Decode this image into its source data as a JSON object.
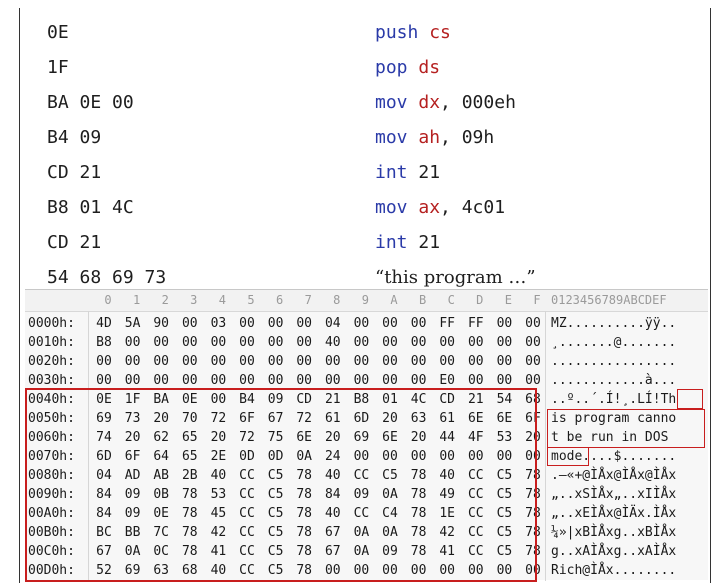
{
  "assembly_lines": [
    {
      "hex": "0E",
      "parts": [
        [
          "mn",
          "push"
        ],
        [
          "op",
          " "
        ],
        [
          "rg",
          "cs"
        ]
      ]
    },
    {
      "hex": "1F",
      "parts": [
        [
          "mn",
          "pop"
        ],
        [
          "op",
          " "
        ],
        [
          "rg",
          "ds"
        ]
      ]
    },
    {
      "hex": "BA 0E 00",
      "parts": [
        [
          "mn",
          "mov"
        ],
        [
          "op",
          " "
        ],
        [
          "rg",
          "dx"
        ],
        [
          "op",
          ", 000eh"
        ]
      ]
    },
    {
      "hex": "B4 09",
      "parts": [
        [
          "mn",
          "mov"
        ],
        [
          "op",
          " "
        ],
        [
          "rg",
          "ah"
        ],
        [
          "op",
          ", 09h"
        ]
      ]
    },
    {
      "hex": "CD 21",
      "parts": [
        [
          "mn",
          "int"
        ],
        [
          "op",
          " 21"
        ]
      ]
    },
    {
      "hex": "B8 01 4C",
      "parts": [
        [
          "mn",
          "mov"
        ],
        [
          "op",
          " "
        ],
        [
          "rg",
          "ax"
        ],
        [
          "op",
          ", 4c01"
        ]
      ]
    },
    {
      "hex": "CD 21",
      "parts": [
        [
          "mn",
          "int"
        ],
        [
          "op",
          " 21"
        ]
      ]
    },
    {
      "hex": "54 68 69 73",
      "parts": [
        [
          "str",
          "“this program …”"
        ]
      ]
    }
  ],
  "hex_editor": {
    "column_headers": [
      "0",
      "1",
      "2",
      "3",
      "4",
      "5",
      "6",
      "7",
      "8",
      "9",
      "A",
      "B",
      "C",
      "D",
      "E",
      "F"
    ],
    "ascii_header": "0123456789ABCDEF",
    "rows": [
      {
        "addr": "0000h:",
        "bytes": [
          "4D",
          "5A",
          "90",
          "00",
          "03",
          "00",
          "00",
          "00",
          "04",
          "00",
          "00",
          "00",
          "FF",
          "FF",
          "00",
          "00"
        ],
        "ascii": "MZ..........ÿÿ.."
      },
      {
        "addr": "0010h:",
        "bytes": [
          "B8",
          "00",
          "00",
          "00",
          "00",
          "00",
          "00",
          "00",
          "40",
          "00",
          "00",
          "00",
          "00",
          "00",
          "00",
          "00"
        ],
        "ascii": "¸.......@......."
      },
      {
        "addr": "0020h:",
        "bytes": [
          "00",
          "00",
          "00",
          "00",
          "00",
          "00",
          "00",
          "00",
          "00",
          "00",
          "00",
          "00",
          "00",
          "00",
          "00",
          "00"
        ],
        "ascii": "................"
      },
      {
        "addr": "0030h:",
        "bytes": [
          "00",
          "00",
          "00",
          "00",
          "00",
          "00",
          "00",
          "00",
          "00",
          "00",
          "00",
          "00",
          "E0",
          "00",
          "00",
          "00"
        ],
        "ascii": "............à..."
      },
      {
        "addr": "0040h:",
        "bytes": [
          "0E",
          "1F",
          "BA",
          "0E",
          "00",
          "B4",
          "09",
          "CD",
          "21",
          "B8",
          "01",
          "4C",
          "CD",
          "21",
          "54",
          "68"
        ],
        "ascii": "..º..´.Í!¸.LÍ!Th"
      },
      {
        "addr": "0050h:",
        "bytes": [
          "69",
          "73",
          "20",
          "70",
          "72",
          "6F",
          "67",
          "72",
          "61",
          "6D",
          "20",
          "63",
          "61",
          "6E",
          "6E",
          "6F"
        ],
        "ascii": "is program canno"
      },
      {
        "addr": "0060h:",
        "bytes": [
          "74",
          "20",
          "62",
          "65",
          "20",
          "72",
          "75",
          "6E",
          "20",
          "69",
          "6E",
          "20",
          "44",
          "4F",
          "53",
          "20"
        ],
        "ascii": "t be run in DOS "
      },
      {
        "addr": "0070h:",
        "bytes": [
          "6D",
          "6F",
          "64",
          "65",
          "2E",
          "0D",
          "0D",
          "0A",
          "24",
          "00",
          "00",
          "00",
          "00",
          "00",
          "00",
          "00"
        ],
        "ascii": "mode....$......."
      },
      {
        "addr": "0080h:",
        "bytes": [
          "04",
          "AD",
          "AB",
          "2B",
          "40",
          "CC",
          "C5",
          "78",
          "40",
          "CC",
          "C5",
          "78",
          "40",
          "CC",
          "C5",
          "78"
        ],
        "ascii": ".–«+@ÌÅx@ÌÅx@ÌÅx"
      },
      {
        "addr": "0090h:",
        "bytes": [
          "84",
          "09",
          "0B",
          "78",
          "53",
          "CC",
          "C5",
          "78",
          "84",
          "09",
          "0A",
          "78",
          "49",
          "CC",
          "C5",
          "78"
        ],
        "ascii": "„..xSÌÅx„..xIÌÅx"
      },
      {
        "addr": "00A0h:",
        "bytes": [
          "84",
          "09",
          "0E",
          "78",
          "45",
          "CC",
          "C5",
          "78",
          "40",
          "CC",
          "C4",
          "78",
          "1E",
          "CC",
          "C5",
          "78"
        ],
        "ascii": "„..xEÌÅx@ÌÄx.ÌÅx"
      },
      {
        "addr": "00B0h:",
        "bytes": [
          "BC",
          "BB",
          "7C",
          "78",
          "42",
          "CC",
          "C5",
          "78",
          "67",
          "0A",
          "0A",
          "78",
          "42",
          "CC",
          "C5",
          "78"
        ],
        "ascii": "¼»|xBÌÅxg..xBÌÅx"
      },
      {
        "addr": "00C0h:",
        "bytes": [
          "67",
          "0A",
          "0C",
          "78",
          "41",
          "CC",
          "C5",
          "78",
          "67",
          "0A",
          "09",
          "78",
          "41",
          "CC",
          "C5",
          "78"
        ],
        "ascii": "g..xAÌÅxg..xAÌÅx"
      },
      {
        "addr": "00D0h:",
        "bytes": [
          "52",
          "69",
          "63",
          "68",
          "40",
          "CC",
          "C5",
          "78",
          "00",
          "00",
          "00",
          "00",
          "00",
          "00",
          "00",
          "00"
        ],
        "ascii": "Rich@ÌÅx........"
      }
    ]
  },
  "highlight_color": "#c81e1e"
}
